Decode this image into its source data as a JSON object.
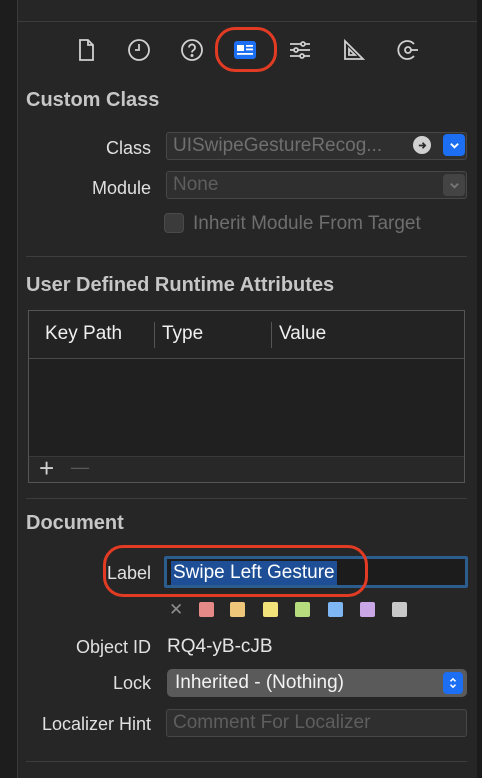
{
  "toolbar": {
    "icons": [
      "file-inspector-icon",
      "history-icon",
      "quick-help-icon",
      "identity-inspector-icon",
      "attributes-inspector-icon",
      "size-inspector-icon",
      "connections-inspector-icon"
    ],
    "selected": "identity-inspector-icon"
  },
  "custom_class": {
    "title": "Custom Class",
    "class_label": "Class",
    "class_value": "UISwipeGestureRecog...",
    "module_label": "Module",
    "module_placeholder": "None",
    "inherit_label": "Inherit Module From Target"
  },
  "runtime_attributes": {
    "title": "User Defined Runtime Attributes",
    "columns": [
      "Key Path",
      "Type",
      "Value"
    ],
    "add_symbol": "+",
    "remove_symbol": "—"
  },
  "document": {
    "title": "Document",
    "label_label": "Label",
    "label_value": "Swipe Left Gesture",
    "clear_symbol": "✕",
    "object_id_label": "Object ID",
    "object_id_value": "RQ4-yB-cJB",
    "lock_label": "Lock",
    "lock_value": "Inherited - (Nothing)",
    "localizer_label": "Localizer Hint",
    "localizer_placeholder": "Comment For Localizer"
  },
  "colors": {
    "accent": "#1c6ff2",
    "annotation": "#e23b23",
    "label_swatches": [
      "#e58a86",
      "#efc77a",
      "#f1e37a",
      "#b7dc7d",
      "#7eb7f3",
      "#c9a6e6",
      "#c8c8c8"
    ]
  }
}
